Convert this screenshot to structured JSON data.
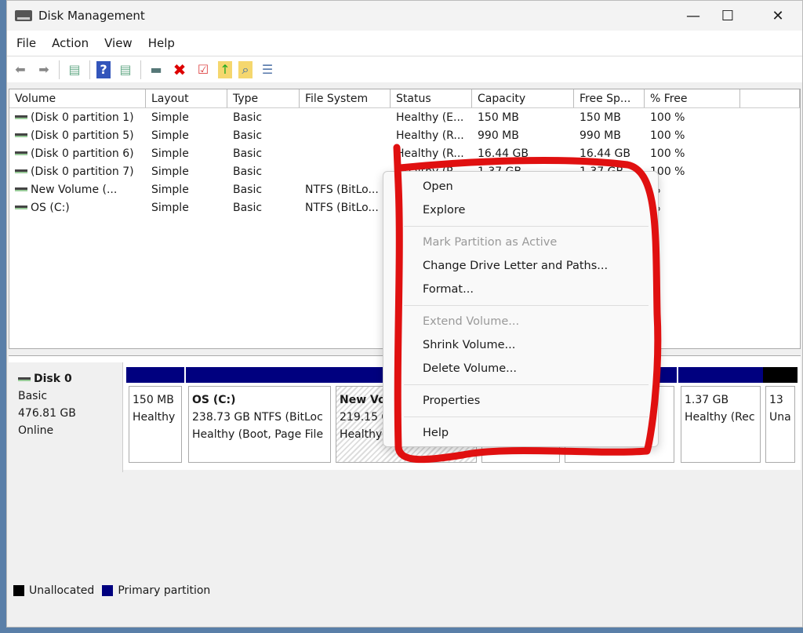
{
  "window": {
    "title": "Disk Management",
    "minimize": "—",
    "maximize": "☐",
    "close": "✕"
  },
  "menu": [
    "File",
    "Action",
    "View",
    "Help"
  ],
  "toolbar": {
    "icons": [
      "back-icon",
      "forward-icon",
      "console-tree-icon",
      "help-icon",
      "action-pane-icon",
      "connect-drive-icon",
      "delete-icon",
      "check-icon",
      "folder-up-icon",
      "folder-search-icon",
      "properties-list-icon"
    ]
  },
  "volume_list": {
    "columns": [
      "Volume",
      "Layout",
      "Type",
      "File System",
      "Status",
      "Capacity",
      "Free Sp...",
      "% Free"
    ],
    "rows": [
      [
        "(Disk 0 partition 1)",
        "Simple",
        "Basic",
        "",
        "Healthy (E...",
        "150 MB",
        "150 MB",
        "100 %"
      ],
      [
        "(Disk 0 partition 5)",
        "Simple",
        "Basic",
        "",
        "Healthy (R...",
        "990 MB",
        "990 MB",
        "100 %"
      ],
      [
        "(Disk 0 partition 6)",
        "Simple",
        "Basic",
        "",
        "Healthy (R...",
        "16.44 GB",
        "16.44 GB",
        "100 %"
      ],
      [
        "(Disk 0 partition 7)",
        "Simple",
        "Basic",
        "",
        "Healthy (R...",
        "1.37 GB",
        "1.37 GB",
        "100 %"
      ],
      [
        "New Volume (...",
        "Simple",
        "Basic",
        "NTFS (BitLo...",
        "",
        "",
        "",
        "%"
      ],
      [
        "OS (C:)",
        "Simple",
        "Basic",
        "NTFS (BitLo...",
        "",
        "",
        "",
        "%"
      ]
    ]
  },
  "disk": {
    "name": "Disk 0",
    "type": "Basic",
    "size": "476.81 GB",
    "state": "Online",
    "partitions": [
      {
        "title": "",
        "line1": "150 MB",
        "line2": "Healthy"
      },
      {
        "title": "OS  (C:)",
        "line1": "238.73 GB NTFS (BitLoc",
        "line2": "Healthy (Boot, Page File"
      },
      {
        "title": "New Vo",
        "line1": "219.15 G",
        "line2": "Healthy"
      },
      {
        "title": "",
        "line1": "",
        "line2": ""
      },
      {
        "title": "",
        "line1": "",
        "line2": "ery"
      },
      {
        "title": "",
        "line1": "1.37 GB",
        "line2": "Healthy (Rec"
      },
      {
        "title": "",
        "line1": "13",
        "line2": "Una"
      }
    ]
  },
  "context_menu": [
    {
      "label": "Open",
      "disabled": false
    },
    {
      "label": "Explore",
      "disabled": false
    },
    {
      "sep": true
    },
    {
      "label": "Mark Partition as Active",
      "disabled": true
    },
    {
      "label": "Change Drive Letter and Paths...",
      "disabled": false
    },
    {
      "label": "Format...",
      "disabled": false
    },
    {
      "sep": true
    },
    {
      "label": "Extend Volume...",
      "disabled": true
    },
    {
      "label": "Shrink Volume...",
      "disabled": false
    },
    {
      "label": "Delete Volume...",
      "disabled": false
    },
    {
      "sep": true
    },
    {
      "label": "Properties",
      "disabled": false
    },
    {
      "sep": true
    },
    {
      "label": "Help",
      "disabled": false
    }
  ],
  "legend": [
    {
      "label": "Unallocated",
      "color": "#000000"
    },
    {
      "label": "Primary partition",
      "color": "#00007f"
    }
  ],
  "colors": {
    "primary": "#00007f",
    "annotation": "#e01010"
  }
}
